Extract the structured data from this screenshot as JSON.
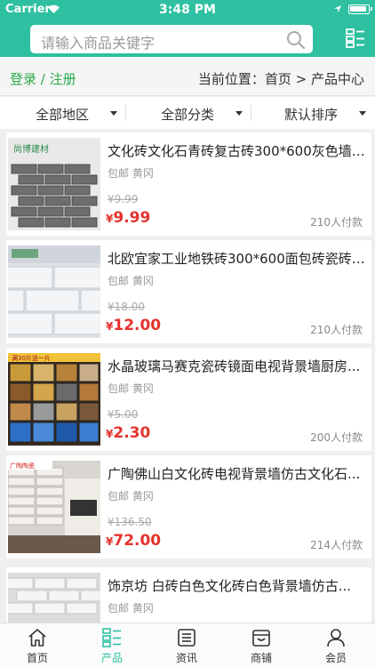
{
  "status": {
    "carrier": "Carrier",
    "time": "3:48 PM"
  },
  "search": {
    "placeholder": "请输入商品关键字"
  },
  "subhead": {
    "login": "登录 / 注册",
    "breadcrumb": "当前位置：首页 > 产品中心"
  },
  "filters": [
    "全部地区",
    "全部分类",
    "默认排序"
  ],
  "products": [
    {
      "title": "文化砖文化石青砖复古砖300*600灰色墙砖...",
      "meta": "包邮 黄冈",
      "old_price": "¥9.99",
      "price_symbol": "¥",
      "price": "9.99",
      "sold": "210人付款",
      "thumb": "gray-brick-icon",
      "brand_tag": "尚博建材"
    },
    {
      "title": "北欧宜家工业地铁砖300*600面包砖瓷砖 ...",
      "meta": "包邮 黄冈",
      "old_price": "¥18.00",
      "price_symbol": "¥",
      "price": "12.00",
      "sold": "210人付款",
      "thumb": "white-tile-icon",
      "brand_tag": ""
    },
    {
      "title": "水晶玻璃马赛克瓷砖镜面电视背景墙厨房...",
      "meta": "包邮 黄冈",
      "old_price": "¥5.00",
      "price_symbol": "¥",
      "price": "2.30",
      "sold": "200人付款",
      "thumb": "mosaic-icon",
      "brand_tag": "满30片送一片"
    },
    {
      "title": "广陶佛山白文化砖电视背景墙仿古文化石...",
      "meta": "包邮 黄冈",
      "old_price": "¥136.50",
      "price_symbol": "¥",
      "price": "72.00",
      "sold": "214人付款",
      "thumb": "white-culture-brick-icon",
      "brand_tag": "广陶陶瓷"
    },
    {
      "title": "饰京坊 白砖白色文化砖白色背景墙仿古...",
      "meta": "包邮 黄冈",
      "old_price": "",
      "price_symbol": "",
      "price": "",
      "sold": "",
      "thumb": "white-brick-icon",
      "brand_tag": ""
    }
  ],
  "tabs": [
    {
      "label": "首页",
      "icon": "home-icon"
    },
    {
      "label": "产品",
      "icon": "product-icon"
    },
    {
      "label": "资讯",
      "icon": "news-icon"
    },
    {
      "label": "商铺",
      "icon": "shop-icon"
    },
    {
      "label": "会员",
      "icon": "member-icon"
    }
  ],
  "colors": {
    "accent": "#2ec0a1",
    "price": "#e4332d",
    "login": "#2aa94b"
  }
}
